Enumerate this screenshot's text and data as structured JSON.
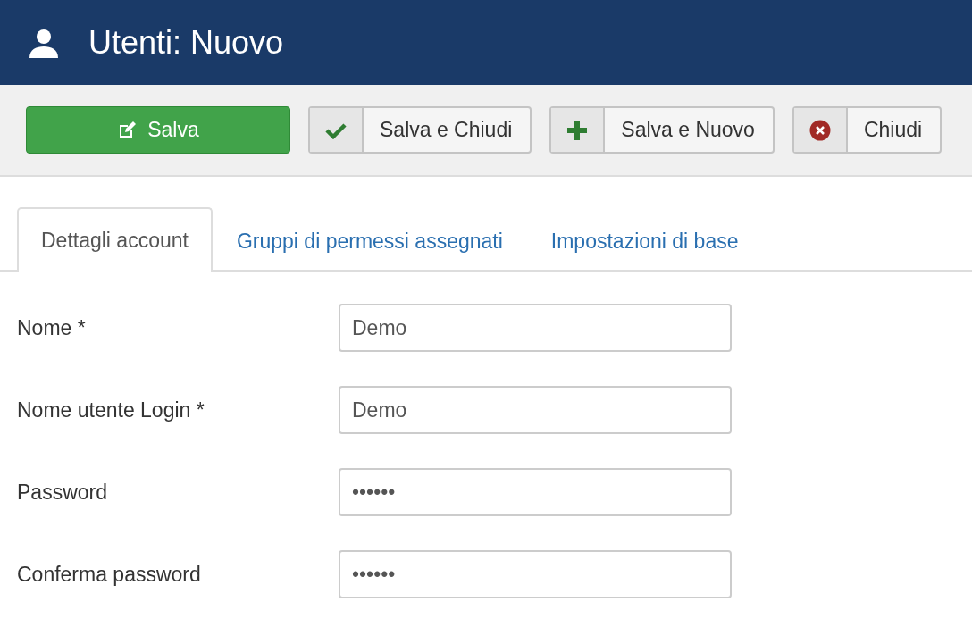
{
  "header": {
    "title": "Utenti: Nuovo"
  },
  "toolbar": [
    {
      "label": "Salva",
      "kind": "save"
    },
    {
      "label": "Salva e Chiudi",
      "kind": "saveclose"
    },
    {
      "label": "Salva e Nuovo",
      "kind": "savenew"
    },
    {
      "label": "Chiudi",
      "kind": "close"
    }
  ],
  "tabs": [
    {
      "label": "Dettagli account",
      "selected": true
    },
    {
      "label": "Gruppi di permessi assegnati",
      "selected": false
    },
    {
      "label": "Impostazioni di base",
      "selected": false
    }
  ],
  "fields": [
    {
      "label": "Nome *",
      "value": "Demo"
    },
    {
      "label": "Nome utente Login *",
      "value": "Demo"
    },
    {
      "label": "Password",
      "value": "••••••"
    },
    {
      "label": "Conferma password",
      "value": "••••••"
    }
  ]
}
